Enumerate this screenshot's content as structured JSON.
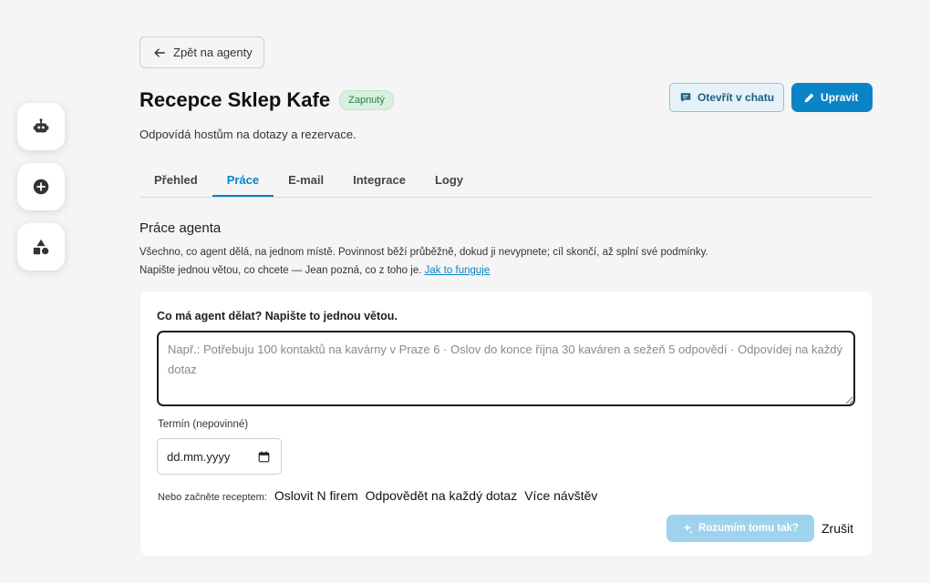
{
  "rail": {
    "items": [
      {
        "icon": "robot-icon"
      },
      {
        "icon": "plus-circle-icon"
      },
      {
        "icon": "shapes-icon"
      }
    ]
  },
  "back_button": {
    "label": "Zpět na agenty",
    "icon": "arrow-left-icon"
  },
  "header": {
    "title": "Recepce Sklep Kafe",
    "status": "Zapnutý",
    "subtitle": "Odpovídá hostům na dotazy a rezervace.",
    "open_chat_label": "Otevřít v chatu",
    "edit_label": "Upravit"
  },
  "tabs": [
    {
      "label": "Přehled",
      "active": false
    },
    {
      "label": "Práce",
      "active": true
    },
    {
      "label": "E-mail",
      "active": false
    },
    {
      "label": "Integrace",
      "active": false
    },
    {
      "label": "Logy",
      "active": false
    }
  ],
  "section": {
    "title": "Práce agenta",
    "description": "Všechno, co agent dělá, na jednom místě. Povinnost běží průběžně, dokud ji nevypnete; cíl skončí, až splní své podmínky. Napište jednou větou, co chcete — Jean pozná, co z toho je.",
    "link": "Jak to funguje"
  },
  "form": {
    "goal_label": "Co má agent dělat? Napište to jednou větou.",
    "goal_placeholder": "Např.: Potřebuju 100 kontaktů na kavárny v Praze 6 · Oslov do konce října 30 kaváren a sežeň 5 odpovědí · Odpovídej na každý dotaz",
    "goal_value": "",
    "deadline_label": "Termín (nepovinné)",
    "deadline_placeholder": "dd.mm.yyyy",
    "recipes_label": "Nebo začněte receptem:",
    "recipes": [
      "Oslovit N firem",
      "Odpovědět na každý dotaz",
      "Více návštěv"
    ],
    "confirm_label": "Rozumím tomu tak?",
    "cancel_label": "Zrušit"
  },
  "colors": {
    "accent": "#0a84c6",
    "accent_disabled": "#9fd3ed",
    "status_bg": "#d8f0de",
    "status_text": "#2e7d45",
    "background": "#f5f5f5"
  }
}
